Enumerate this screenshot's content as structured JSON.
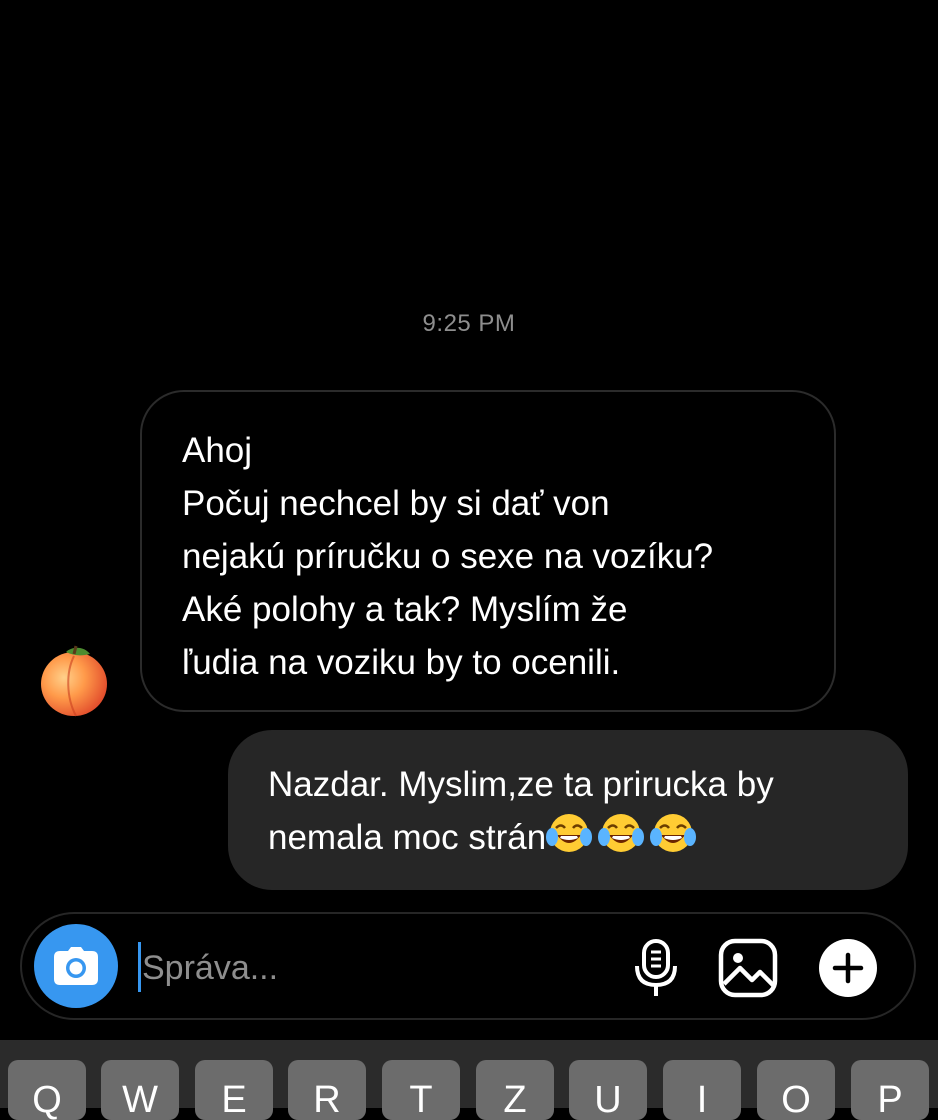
{
  "thread": {
    "timestamp": "9:25 PM",
    "incoming": {
      "lines": [
        "Ahoj",
        "Počuj nechcel by si dať von",
        "nejakú príručku o sexe na vozíku?",
        "Aké polohy a tak? Myslím že",
        "ľudia na voziku by to ocenili."
      ]
    },
    "outgoing": {
      "lines": [
        "Nazdar. Myslim,ze ta prirucka by",
        "nemala moc strán"
      ],
      "trailing_emoji": [
        "face-with-tears-of-joy",
        "face-with-tears-of-joy",
        "face-with-tears-of-joy"
      ]
    }
  },
  "composer": {
    "placeholder": "Správa...",
    "value": ""
  },
  "keyboard": {
    "keys": [
      "Q",
      "W",
      "E",
      "R",
      "T",
      "Z",
      "U",
      "I",
      "O",
      "P"
    ]
  },
  "colors": {
    "accent": "#3797f0",
    "outgoing_bubble": "#262626",
    "timestamp": "#8e8e8e"
  }
}
